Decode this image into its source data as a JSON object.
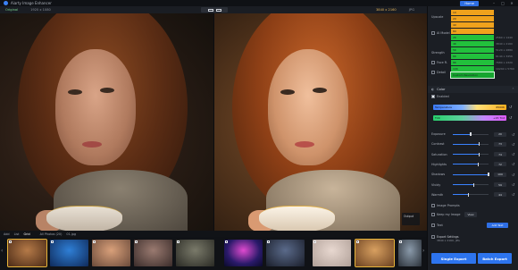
{
  "titlebar": {
    "title": "Aiarty Image Enhancer",
    "home": "Home",
    "min": "–",
    "max": "□",
    "close": "✕"
  },
  "subbar": {
    "mode": "Original",
    "input_dims": "1920 x 1080",
    "output_dims": "3840 x 2160",
    "output_ext": "JPG"
  },
  "panel": {
    "dropdown_label": "Upscale",
    "dropdown_items": [
      {
        "label": "1X",
        "color": "orange"
      },
      {
        "label": "2X",
        "color": "orange"
      },
      {
        "label": "4X",
        "color": "orange"
      },
      {
        "label": "8X",
        "color": "orange"
      },
      {
        "label": "2K",
        "color": "green",
        "side": "2560 x 1440"
      },
      {
        "label": "4K",
        "color": "green",
        "side": "3840 x 2160"
      },
      {
        "label": "5K",
        "color": "green",
        "side": "5120 x 2880"
      },
      {
        "label": "6K",
        "color": "green",
        "side": "6144 x 3456"
      },
      {
        "label": "8K",
        "color": "green",
        "side": "7680 x 4320"
      },
      {
        "label": "10K",
        "color": "green",
        "side": "10240 x 5760"
      },
      {
        "label": "Custom Resolution",
        "color": "sel",
        "side": ""
      }
    ],
    "option_labels": [
      "AI Model",
      "Strength",
      "Face R.",
      "Detail"
    ],
    "color_section": "Color",
    "enabled_label": "Enabled",
    "temperature_label": "Temperature",
    "temperature_value": "6500K",
    "tint_label": "Tint",
    "tint_value": "+15 Tint",
    "sliders": [
      {
        "label": "Exposure",
        "value": "20",
        "fraction": 0.5
      },
      {
        "label": "Contrast",
        "value": "73",
        "fraction": 0.73
      },
      {
        "label": "Saturation",
        "value": "74",
        "fraction": 0.74
      },
      {
        "label": "Highlights",
        "value": "72",
        "fraction": 0.72
      },
      {
        "label": "Shadows",
        "value": "100",
        "fraction": 1.0
      },
      {
        "label": "Vividy",
        "value": "59",
        "fraction": 0.59
      },
      {
        "label": "Warmth",
        "value": "44",
        "fraction": 0.44
      }
    ],
    "image_prompts_label": "Image Prompts",
    "keep_image_label": "Keep my Image",
    "view_label": "View",
    "text_label": "Text",
    "add_text_label": "Add Text",
    "export_settings_title": "Export Settings",
    "export_settings_detail": "3840 x 2160, JPG",
    "single_export": "Single Export",
    "batch_export": "Batch Export"
  },
  "filmstrip": {
    "tabs": [
      "Add",
      "List",
      "Grid"
    ],
    "active_tab": "Grid",
    "count_label": "All Photos (20)",
    "current_file": "01.jpg"
  },
  "compare_badge": "Output",
  "colors": {
    "accent": "#2d74ee",
    "orange": "#f0a21c",
    "green": "#22c03c"
  }
}
